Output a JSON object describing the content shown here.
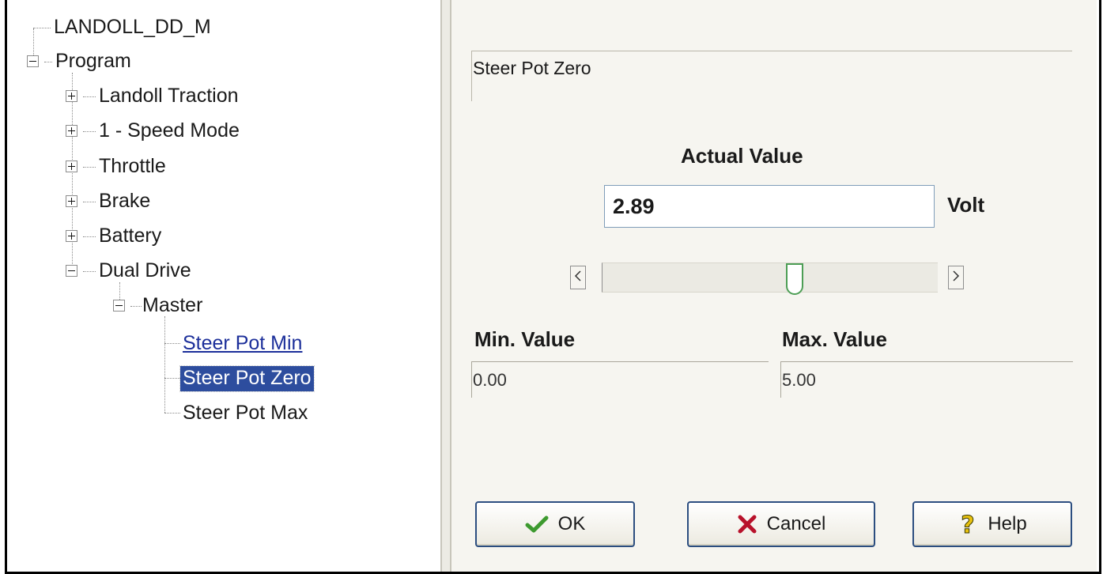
{
  "tree": {
    "root_label": "LANDOLL_DD_M",
    "program_label": "Program",
    "items": [
      {
        "label": "Landoll Traction"
      },
      {
        "label": "1 - Speed Mode"
      },
      {
        "label": "Throttle"
      },
      {
        "label": "Brake"
      },
      {
        "label": "Battery"
      },
      {
        "label": "Dual Drive"
      }
    ],
    "master_label": "Master",
    "leaves": [
      {
        "label": "Steer Pot Min"
      },
      {
        "label": "Steer Pot Zero"
      },
      {
        "label": "Steer Pot Max"
      }
    ]
  },
  "panel": {
    "description": "Steer Pot Zero",
    "actual_label": "Actual Value",
    "actual_value": "2.89",
    "unit": "Volt",
    "slider_fraction": 0.578,
    "min_label": "Min. Value",
    "min_value": "0.00",
    "max_label": "Max. Value",
    "max_value": "5.00"
  },
  "buttons": {
    "ok": "OK",
    "cancel": "Cancel",
    "help": "Help"
  },
  "colors": {
    "selection": "#2d4d9e",
    "link": "#1c2f9a",
    "slider_thumb": "#4d9e55",
    "button_border": "#2c4e80"
  },
  "icons": {
    "ok": "check-icon",
    "cancel": "x-icon",
    "help": "question-icon"
  }
}
